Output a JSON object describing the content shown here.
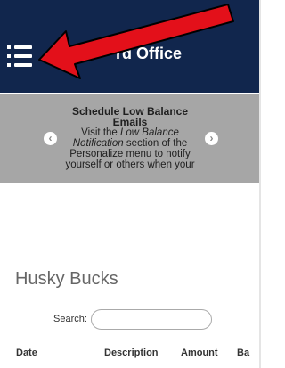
{
  "header": {
    "title": "rd Office",
    "menu_icon": "hamburger-menu-icon",
    "background": "#11264d",
    "annotation_arrow_color": "#e3101a"
  },
  "banner": {
    "heading_line1": "Schedule Low Balance",
    "heading_line2": "Emails",
    "text_before": "Visit the ",
    "text_em_1": "Low Balance",
    "text_em_2": "Notification",
    "text_after": " section of the Personalize menu to notify yourself or others when your",
    "prev_icon": "chevron-left-icon",
    "next_icon": "chevron-right-icon",
    "prev_glyph": "‹",
    "next_glyph": "›",
    "background": "#a6a6a6"
  },
  "main": {
    "section_title": "Husky Bucks",
    "search_label": "Search:",
    "search_value": "",
    "table": {
      "columns": [
        "Date",
        "Description",
        "Amount",
        "Ba"
      ]
    }
  }
}
